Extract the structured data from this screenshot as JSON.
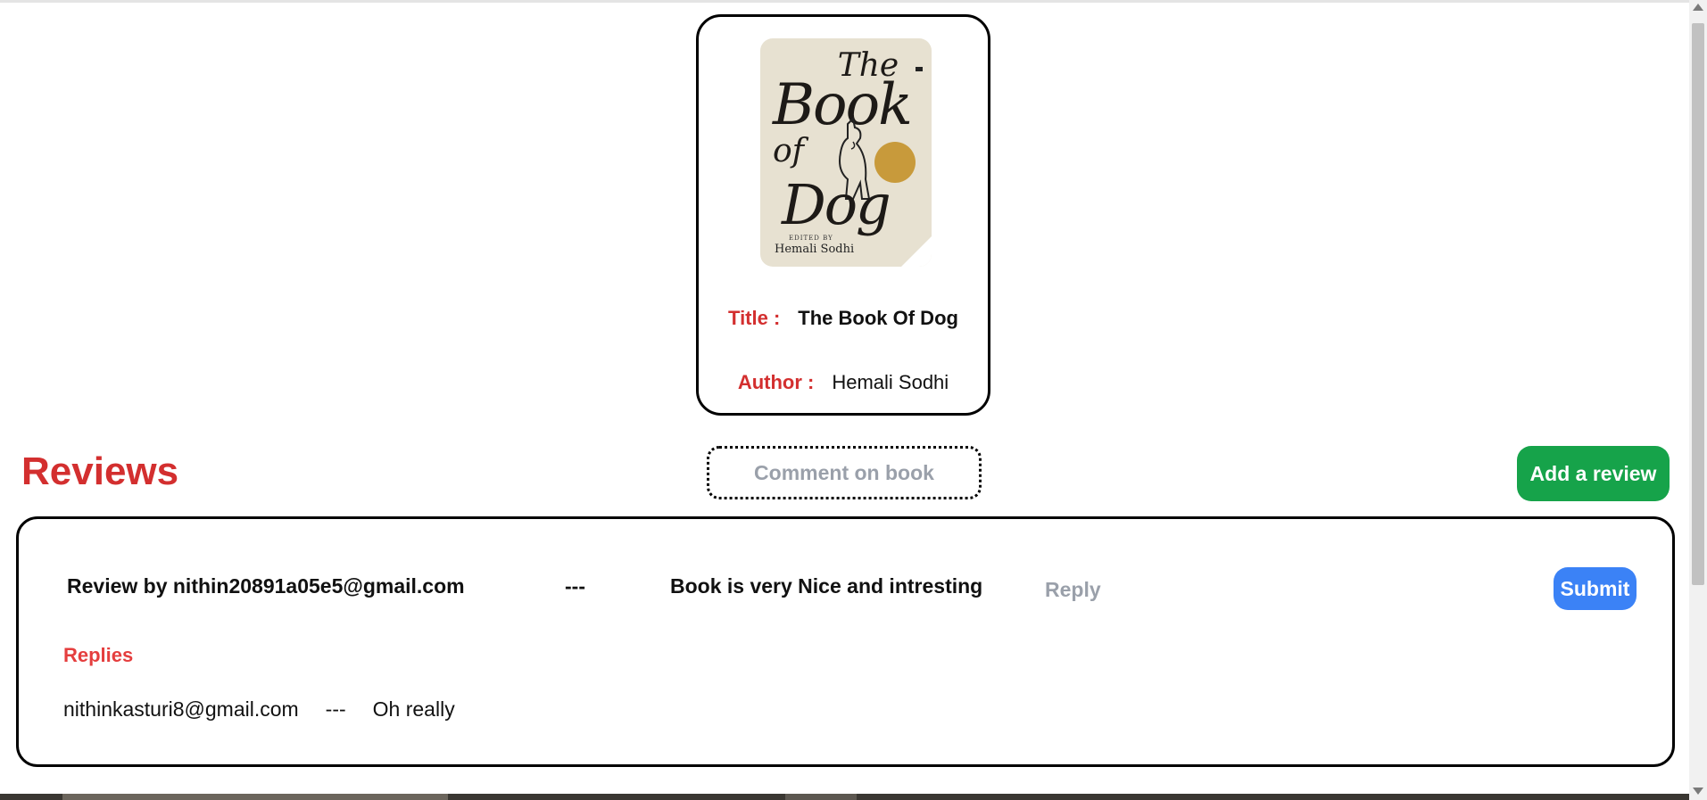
{
  "book": {
    "cover": {
      "the": "The",
      "book": "Book",
      "of": "of",
      "dog": "Dog",
      "edited_by": "EDITED BY",
      "author": "Hemali Sodhi"
    },
    "title_label": "Title :",
    "title_value": "The Book Of Dog",
    "author_label": "Author :",
    "author_value": "Hemali Sodhi"
  },
  "reviews_section": {
    "heading": "Reviews",
    "comment_placeholder": "Comment on book",
    "add_review_label": "Add a review"
  },
  "reviews": [
    {
      "by": "Review by nithin20891a05e5@gmail.com",
      "separator": "---",
      "text": "Book is very Nice and intresting",
      "reply_placeholder": "Reply",
      "submit_label": "Submit",
      "replies_label": "Replies",
      "replies": [
        {
          "user": "nithinkasturi8@gmail.com",
          "separator": "---",
          "text": "Oh really"
        }
      ]
    }
  ],
  "colors": {
    "label_red": "#d32f2f",
    "add_review_green": "#16a34a",
    "submit_blue": "#3b82f6",
    "placeholder_gray": "#9aa0aa"
  }
}
